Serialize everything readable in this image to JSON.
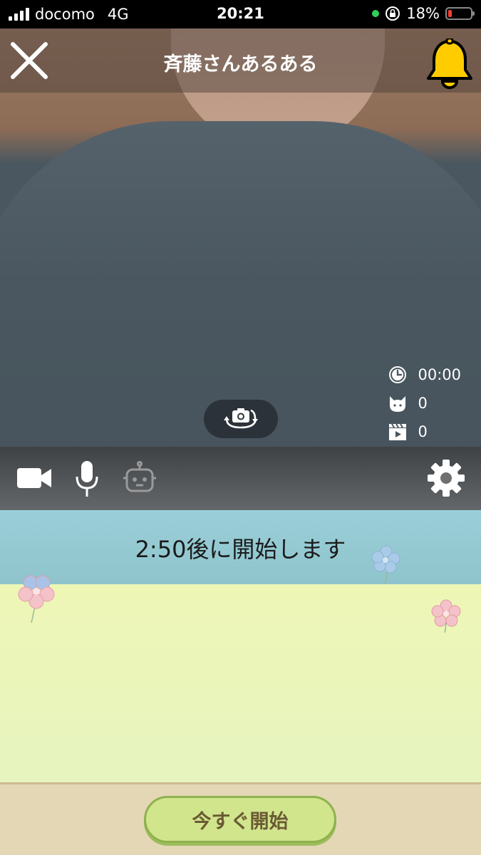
{
  "status_bar": {
    "carrier": "docomo",
    "network": "4G",
    "time": "20:21",
    "battery": "18%"
  },
  "header": {
    "title": "斉藤さんあるある"
  },
  "stats": {
    "elapsed_time": "00:00",
    "viewers": "0",
    "videos": "0"
  },
  "countdown": {
    "text": "2:50後に開始します"
  },
  "actions": {
    "start_now_label": "今すぐ開始"
  },
  "icons": {
    "close": "close-icon",
    "bell": "bell-icon",
    "clock": "clock-icon",
    "cat": "cat-icon",
    "clapper": "clapperboard-icon",
    "flip_camera": "flip-camera-icon",
    "video": "video-camera-icon",
    "mic": "microphone-icon",
    "robot": "robot-icon",
    "settings": "gear-icon"
  },
  "colors": {
    "bell": "#ffcc00",
    "banner": "#9acfd9",
    "field": "#eef6b6",
    "start_button": "#d1e58d"
  }
}
